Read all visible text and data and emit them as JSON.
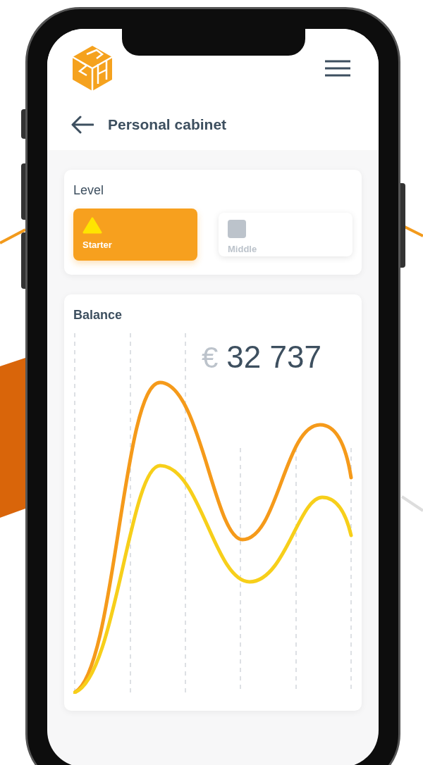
{
  "header": {
    "title": "Personal cabinet"
  },
  "level": {
    "title": "Level",
    "options": [
      {
        "label": "Starter",
        "kind": "triangle",
        "selected": true
      },
      {
        "label": "Middle",
        "kind": "square",
        "selected": false
      }
    ]
  },
  "balance": {
    "title": "Balance",
    "currency": "€",
    "amount": "32 737"
  }
}
